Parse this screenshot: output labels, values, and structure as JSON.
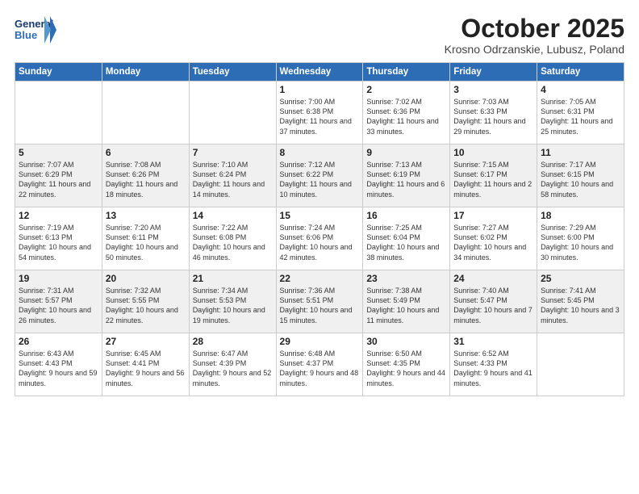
{
  "header": {
    "logo_line1": "General",
    "logo_line2": "Blue",
    "month_title": "October 2025",
    "location": "Krosno Odrzanskie, Lubusz, Poland"
  },
  "days_of_week": [
    "Sunday",
    "Monday",
    "Tuesday",
    "Wednesday",
    "Thursday",
    "Friday",
    "Saturday"
  ],
  "weeks": [
    [
      {
        "day": "",
        "info": ""
      },
      {
        "day": "",
        "info": ""
      },
      {
        "day": "",
        "info": ""
      },
      {
        "day": "1",
        "info": "Sunrise: 7:00 AM\nSunset: 6:38 PM\nDaylight: 11 hours\nand 37 minutes."
      },
      {
        "day": "2",
        "info": "Sunrise: 7:02 AM\nSunset: 6:36 PM\nDaylight: 11 hours\nand 33 minutes."
      },
      {
        "day": "3",
        "info": "Sunrise: 7:03 AM\nSunset: 6:33 PM\nDaylight: 11 hours\nand 29 minutes."
      },
      {
        "day": "4",
        "info": "Sunrise: 7:05 AM\nSunset: 6:31 PM\nDaylight: 11 hours\nand 25 minutes."
      }
    ],
    [
      {
        "day": "5",
        "info": "Sunrise: 7:07 AM\nSunset: 6:29 PM\nDaylight: 11 hours\nand 22 minutes."
      },
      {
        "day": "6",
        "info": "Sunrise: 7:08 AM\nSunset: 6:26 PM\nDaylight: 11 hours\nand 18 minutes."
      },
      {
        "day": "7",
        "info": "Sunrise: 7:10 AM\nSunset: 6:24 PM\nDaylight: 11 hours\nand 14 minutes."
      },
      {
        "day": "8",
        "info": "Sunrise: 7:12 AM\nSunset: 6:22 PM\nDaylight: 11 hours\nand 10 minutes."
      },
      {
        "day": "9",
        "info": "Sunrise: 7:13 AM\nSunset: 6:19 PM\nDaylight: 11 hours\nand 6 minutes."
      },
      {
        "day": "10",
        "info": "Sunrise: 7:15 AM\nSunset: 6:17 PM\nDaylight: 11 hours\nand 2 minutes."
      },
      {
        "day": "11",
        "info": "Sunrise: 7:17 AM\nSunset: 6:15 PM\nDaylight: 10 hours\nand 58 minutes."
      }
    ],
    [
      {
        "day": "12",
        "info": "Sunrise: 7:19 AM\nSunset: 6:13 PM\nDaylight: 10 hours\nand 54 minutes."
      },
      {
        "day": "13",
        "info": "Sunrise: 7:20 AM\nSunset: 6:11 PM\nDaylight: 10 hours\nand 50 minutes."
      },
      {
        "day": "14",
        "info": "Sunrise: 7:22 AM\nSunset: 6:08 PM\nDaylight: 10 hours\nand 46 minutes."
      },
      {
        "day": "15",
        "info": "Sunrise: 7:24 AM\nSunset: 6:06 PM\nDaylight: 10 hours\nand 42 minutes."
      },
      {
        "day": "16",
        "info": "Sunrise: 7:25 AM\nSunset: 6:04 PM\nDaylight: 10 hours\nand 38 minutes."
      },
      {
        "day": "17",
        "info": "Sunrise: 7:27 AM\nSunset: 6:02 PM\nDaylight: 10 hours\nand 34 minutes."
      },
      {
        "day": "18",
        "info": "Sunrise: 7:29 AM\nSunset: 6:00 PM\nDaylight: 10 hours\nand 30 minutes."
      }
    ],
    [
      {
        "day": "19",
        "info": "Sunrise: 7:31 AM\nSunset: 5:57 PM\nDaylight: 10 hours\nand 26 minutes."
      },
      {
        "day": "20",
        "info": "Sunrise: 7:32 AM\nSunset: 5:55 PM\nDaylight: 10 hours\nand 22 minutes."
      },
      {
        "day": "21",
        "info": "Sunrise: 7:34 AM\nSunset: 5:53 PM\nDaylight: 10 hours\nand 19 minutes."
      },
      {
        "day": "22",
        "info": "Sunrise: 7:36 AM\nSunset: 5:51 PM\nDaylight: 10 hours\nand 15 minutes."
      },
      {
        "day": "23",
        "info": "Sunrise: 7:38 AM\nSunset: 5:49 PM\nDaylight: 10 hours\nand 11 minutes."
      },
      {
        "day": "24",
        "info": "Sunrise: 7:40 AM\nSunset: 5:47 PM\nDaylight: 10 hours\nand 7 minutes."
      },
      {
        "day": "25",
        "info": "Sunrise: 7:41 AM\nSunset: 5:45 PM\nDaylight: 10 hours\nand 3 minutes."
      }
    ],
    [
      {
        "day": "26",
        "info": "Sunrise: 6:43 AM\nSunset: 4:43 PM\nDaylight: 9 hours\nand 59 minutes."
      },
      {
        "day": "27",
        "info": "Sunrise: 6:45 AM\nSunset: 4:41 PM\nDaylight: 9 hours\nand 56 minutes."
      },
      {
        "day": "28",
        "info": "Sunrise: 6:47 AM\nSunset: 4:39 PM\nDaylight: 9 hours\nand 52 minutes."
      },
      {
        "day": "29",
        "info": "Sunrise: 6:48 AM\nSunset: 4:37 PM\nDaylight: 9 hours\nand 48 minutes."
      },
      {
        "day": "30",
        "info": "Sunrise: 6:50 AM\nSunset: 4:35 PM\nDaylight: 9 hours\nand 44 minutes."
      },
      {
        "day": "31",
        "info": "Sunrise: 6:52 AM\nSunset: 4:33 PM\nDaylight: 9 hours\nand 41 minutes."
      },
      {
        "day": "",
        "info": ""
      }
    ]
  ]
}
